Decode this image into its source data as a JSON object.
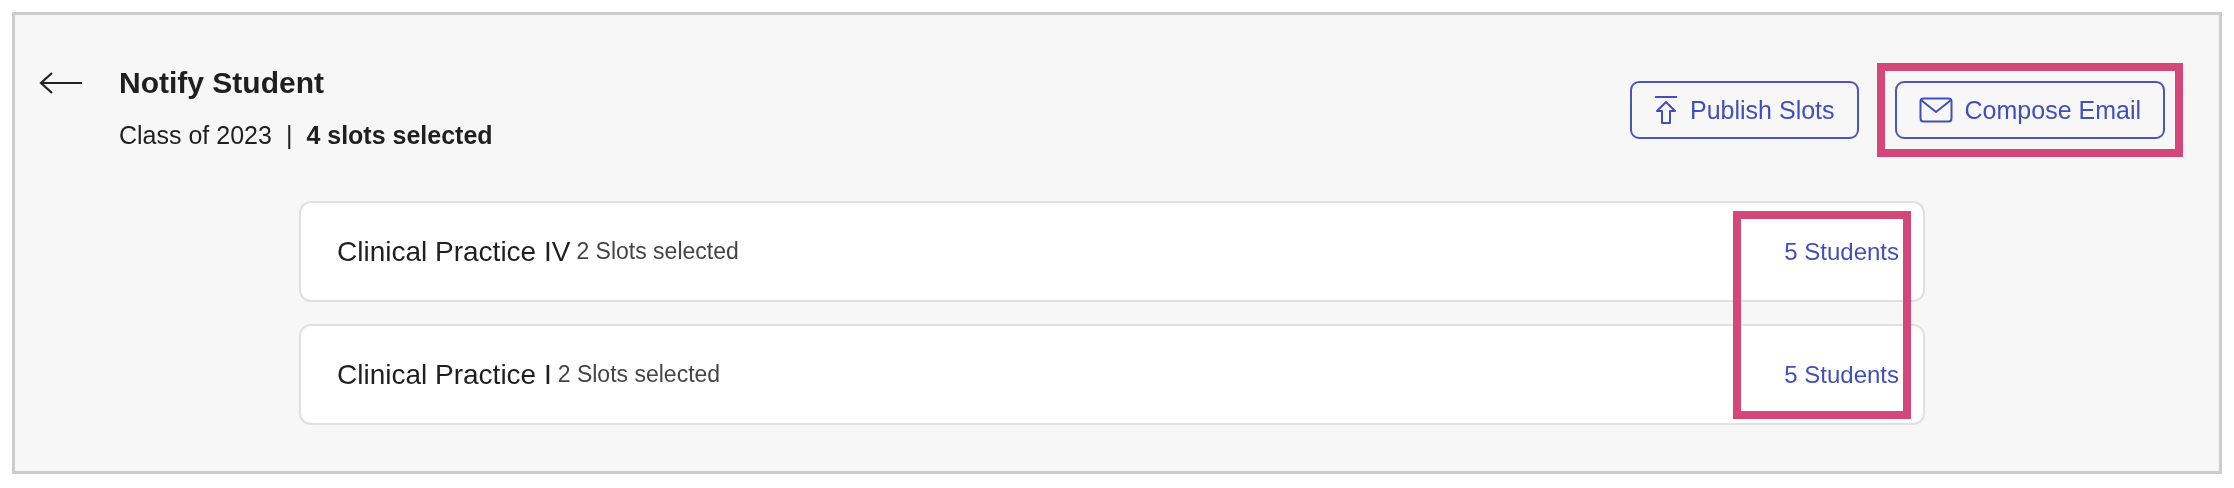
{
  "header": {
    "title": "Notify Student",
    "class_label": "Class of 2023",
    "separator": "|",
    "selection": "4 slots selected"
  },
  "actions": [
    {
      "label": "Publish Slots",
      "kind": "upload",
      "highlighted": false
    },
    {
      "label": "Compose Email",
      "kind": "mail",
      "highlighted": true
    }
  ],
  "courses": {
    "students_highlighted": true,
    "items": [
      {
        "name": "Clinical Practice IV",
        "slots": "2 Slots selected",
        "students": "5 Students"
      },
      {
        "name": "Clinical Practice I",
        "slots": "2 Slots selected",
        "students": "5 Students"
      }
    ]
  }
}
